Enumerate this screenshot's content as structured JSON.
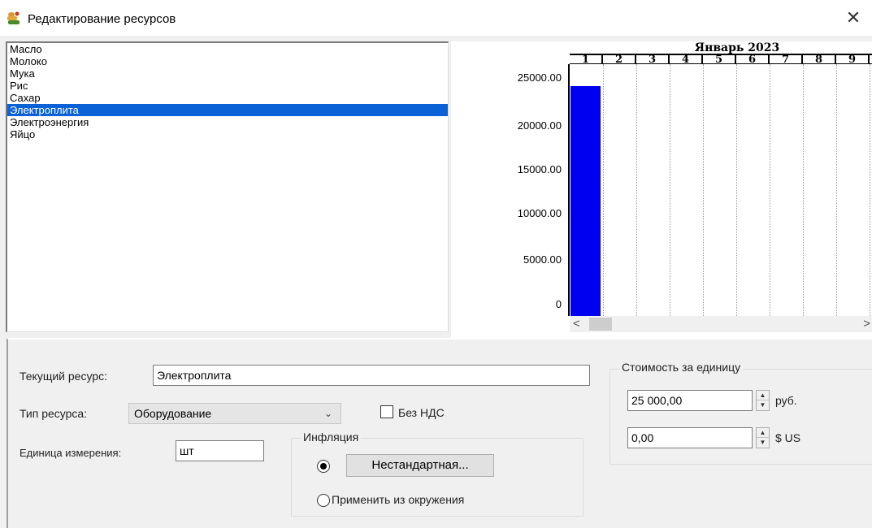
{
  "window": {
    "title": "Редактирование ресурсов",
    "close_glyph": "✕",
    "icon": "resources-app-icon"
  },
  "resources": {
    "items": [
      "Масло",
      "Молоко",
      "Мука",
      "Рис",
      "Сахар",
      "Электроплита",
      "Электроэнергия",
      "Яйцо"
    ],
    "selected_index": 5
  },
  "chart_data": {
    "type": "bar",
    "title": "Январь 2023",
    "categories": [
      "1",
      "2",
      "3",
      "4",
      "5",
      "6",
      "7",
      "8",
      "9"
    ],
    "values": [
      25000,
      0,
      0,
      0,
      0,
      0,
      0,
      0,
      0
    ],
    "y_ticks": [
      "25000.00",
      "20000.00",
      "15000.00",
      "10000.00",
      "5000.00",
      "0"
    ],
    "ylim": [
      0,
      27400
    ],
    "grid": "vertical dotted",
    "bar_color": "#0000f0"
  },
  "form": {
    "current_resource_label": "Текущий ресурс:",
    "current_resource_value": "Электроплита",
    "resource_type_label": "Тип ресурса:",
    "resource_type_value": "Оборудование",
    "no_vat_label": "Без НДС",
    "no_vat_checked": false,
    "unit_label": "Единица измерения:",
    "unit_value": "шт",
    "inflation": {
      "title": "Инфляция",
      "option_custom_button": "Нестандартная...",
      "option_env_label": "Применить из окружения",
      "selected": "custom"
    },
    "unit_cost": {
      "title": "Стоимость за единицу",
      "rub_value": "25 000,00",
      "rub_currency": "руб.",
      "usd_value": "0,00",
      "usd_currency": "$ US"
    }
  },
  "scrollbar": {
    "left_arrow": "<",
    "right_arrow": ">"
  }
}
